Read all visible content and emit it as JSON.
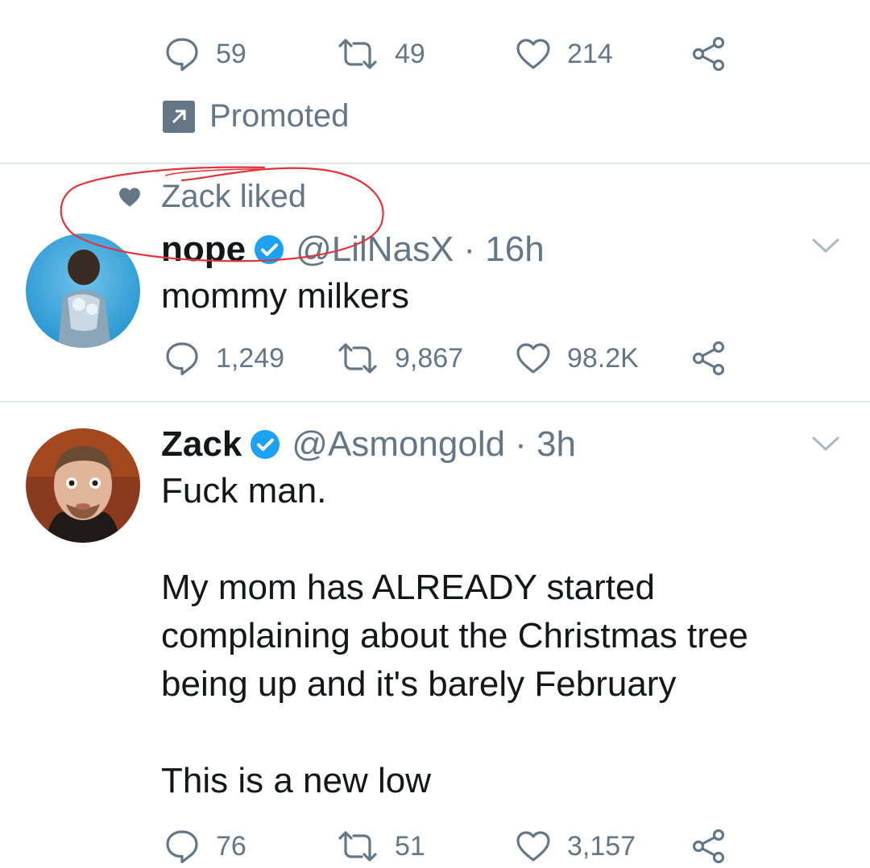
{
  "top_tweet": {
    "reply_count": "59",
    "retweet_count": "49",
    "like_count": "214",
    "promoted_label": "Promoted"
  },
  "liked_tweet": {
    "social_context": "Zack liked",
    "name": "nope",
    "handle": "@LilNasX",
    "time": "· 16h",
    "text": "mommy milkers",
    "reply_count": "1,249",
    "retweet_count": "9,867",
    "like_count": "98.2K"
  },
  "zack_tweet": {
    "name": "Zack",
    "handle": "@Asmongold",
    "time": "· 3h",
    "text": "Fuck man.\n\nMy mom has ALREADY started\ncomplaining about the Christmas tree\nbeing up and it's barely February\n\nThis is a new low",
    "reply_count": "76",
    "retweet_count": "51",
    "like_count": "3,157"
  },
  "colors": {
    "verified": "#1da1f2",
    "muted": "#657786",
    "annotation": "#e0343a"
  }
}
